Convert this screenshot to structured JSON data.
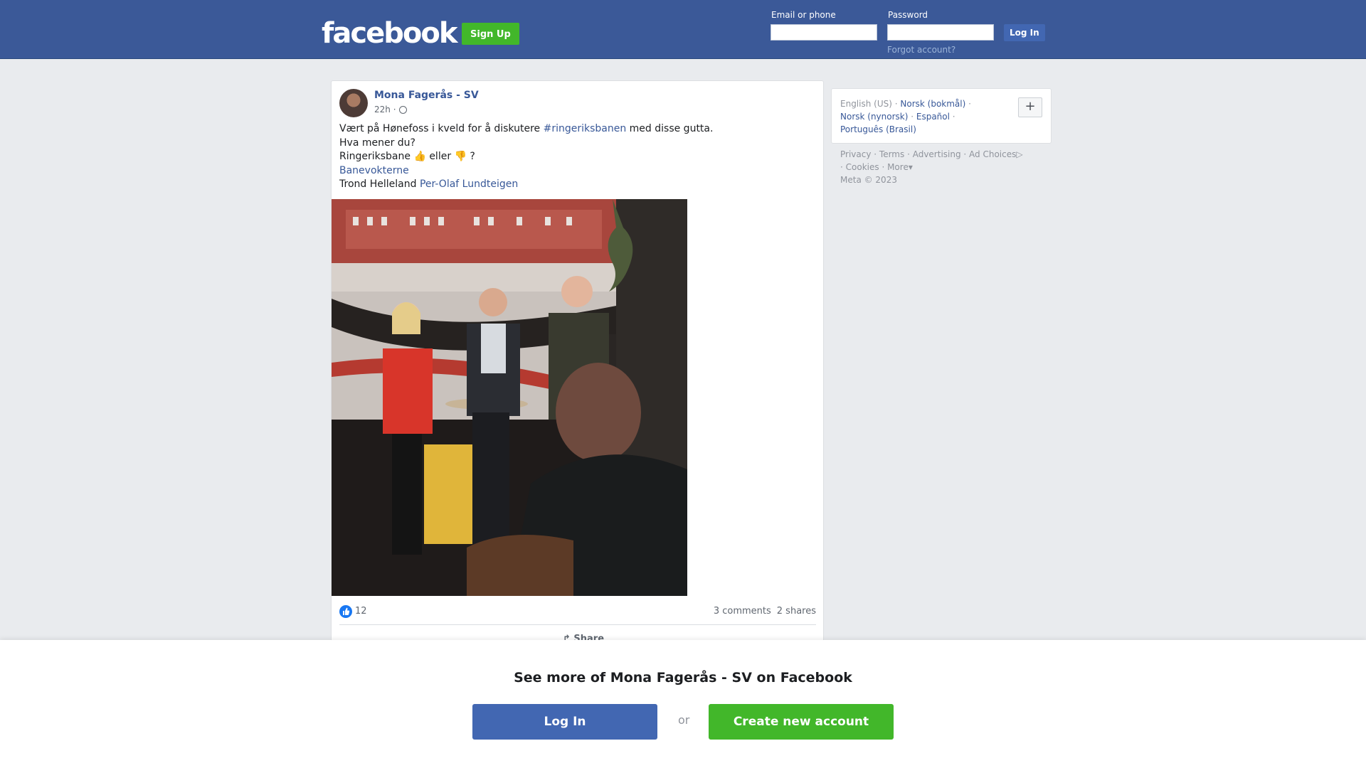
{
  "header": {
    "logo": "facebook",
    "signup_label": "Sign Up",
    "email_label": "Email or phone",
    "password_label": "Password",
    "login_label": "Log In",
    "forgot_label": "Forgot account?"
  },
  "post": {
    "author": "Mona Fagerås - SV",
    "time": "22h ·",
    "line1_prefix": "Vært på Hønefoss i kveld for å diskutere ",
    "hashtag": "#ringeriksbanen",
    "line1_suffix": " med disse gutta.",
    "line2": "Hva mener du?",
    "line3": "Ringeriksbane 👍 eller 👎 ?",
    "line4_link": "Banevokterne",
    "line5_prefix": "Trond Helleland ",
    "line5_link": "Per-Olaf Lundteigen",
    "likes": "12",
    "comments": "3 comments",
    "shares": "2 shares",
    "share_label": "Share"
  },
  "sidebar": {
    "languages": {
      "current": "English (US)",
      "lang1": "Norsk (bokmål)",
      "lang2": "Norsk (nynorsk)",
      "lang3": "Español",
      "lang4": "Português (Brasil)",
      "plus": "+"
    },
    "footer": {
      "privacy": "Privacy",
      "terms": "Terms",
      "advertising": "Advertising",
      "ad_choices": "Ad Choices",
      "cookies": "Cookies",
      "more": "More",
      "meta": "Meta © 2023"
    }
  },
  "bottom": {
    "heading": "See more of Mona Fagerås - SV on Facebook",
    "login_label": "Log In",
    "or_label": "or",
    "create_label": "Create new account"
  },
  "colors": {
    "brand_blue": "#3b5998",
    "signup_green": "#42b72a",
    "link_blue": "#385898"
  }
}
